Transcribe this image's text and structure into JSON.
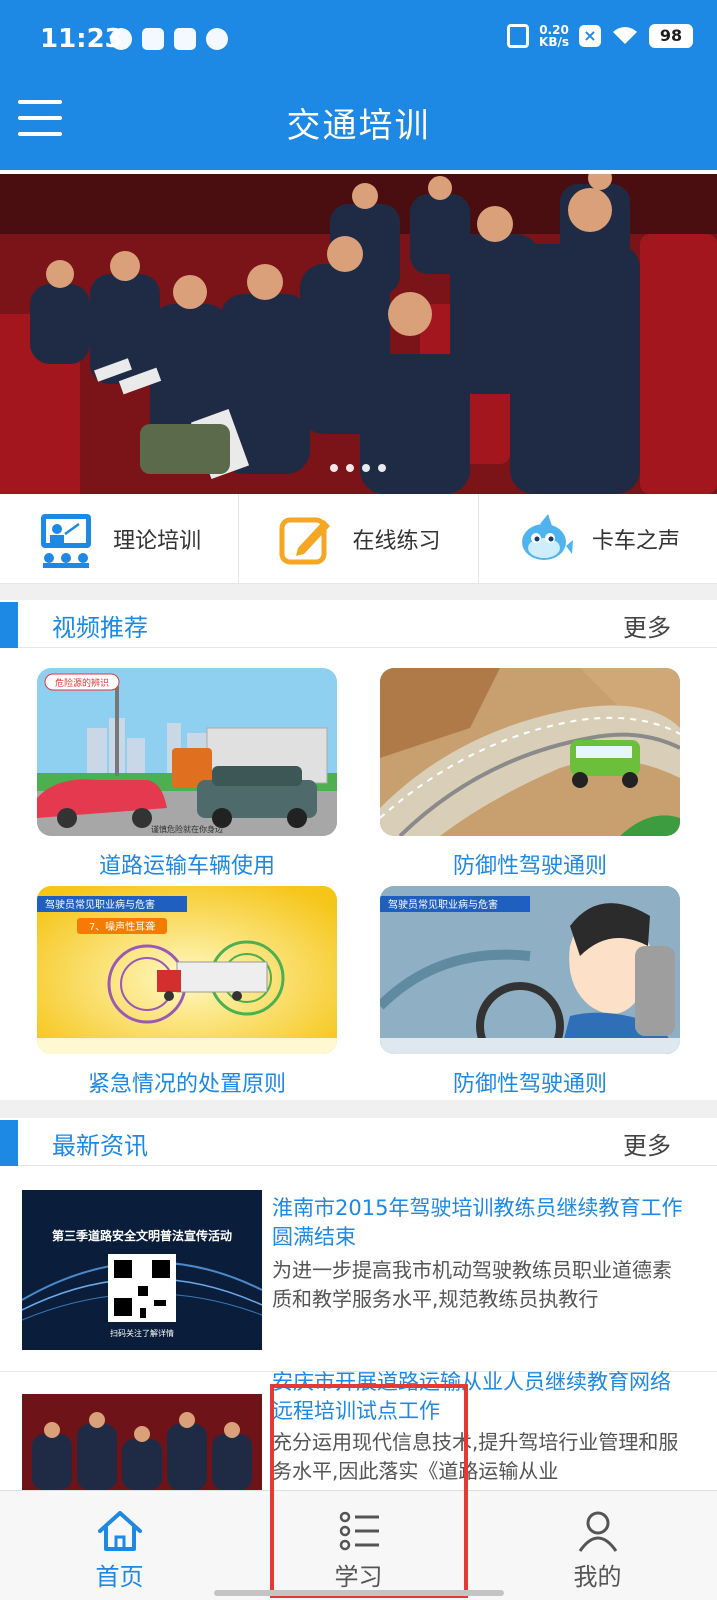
{
  "status_bar": {
    "time": "11:23",
    "speed_value": "0.20",
    "speed_unit": "KB/s",
    "battery": "98"
  },
  "header": {
    "title": "交通培训"
  },
  "quick_nav": [
    {
      "label": "理论培训",
      "icon": "teacher-board-icon"
    },
    {
      "label": "在线练习",
      "icon": "pencil-edit-icon"
    },
    {
      "label": "卡车之声",
      "icon": "dolphin-icon"
    }
  ],
  "videos": {
    "title": "视频推荐",
    "more": "更多",
    "items": [
      {
        "label": "道路运输车辆使用",
        "thumb_caption": "危险源的辨识",
        "thumb_footer": "谨慎危险就在你身边"
      },
      {
        "label": "防御性驾驶通则"
      },
      {
        "label": "紧急情况的处置原则",
        "thumb_caption": "7、噪声性耳聋",
        "thumb_header": "驾驶员常见职业病与危害"
      },
      {
        "label": "防御性驾驶通则",
        "thumb_header": "驾驶员常见职业病与危害"
      }
    ]
  },
  "news": {
    "title": "最新资讯",
    "more": "更多",
    "items": [
      {
        "title": "淮南市2015年驾驶培训教练员继续教育工作圆满结束",
        "desc": "为进一步提高我市机动驾驶教练员职业道德素质和教学服务水平,规范教练员执教行",
        "thumb_caption": "第三季道路安全文明普法宣传活动",
        "thumb_footer": "扫码关注了解详情"
      },
      {
        "title": "安庆市开展道路运输从业人员继续教育网络远程培训试点工作",
        "desc": "充分运用现代信息技术,提升驾培行业管理和服务水平,因此落实《道路运输从业"
      }
    ]
  },
  "tabbar": [
    {
      "label": "首页",
      "icon": "home-icon",
      "active": true
    },
    {
      "label": "学习",
      "icon": "list-icon",
      "active": false
    },
    {
      "label": "我的",
      "icon": "user-icon",
      "active": false
    }
  ],
  "colors": {
    "brand_blue": "#1e88e5",
    "highlight_red": "#e53935"
  }
}
